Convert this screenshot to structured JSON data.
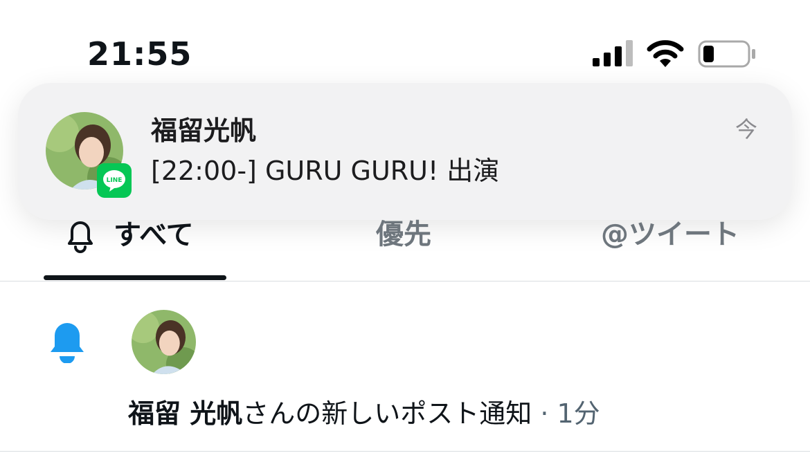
{
  "status_bar": {
    "time": "21:55",
    "icons": [
      "cellular-signal-icon",
      "wifi-icon",
      "battery-icon"
    ]
  },
  "notification_banner": {
    "app_icon": "line-icon",
    "badge_text": "LINE",
    "title": "福留光帆",
    "body": "[22:00-] GURU GURU! 出演",
    "time": "今",
    "colors": {
      "line_green": "#06c755",
      "background": "#f2f2f3"
    }
  },
  "tabs": {
    "items": [
      {
        "label": "すべて",
        "icon": "bell-outline-icon",
        "active": true
      },
      {
        "label": "優先",
        "active": false
      },
      {
        "label": "@ツイート",
        "active": false
      }
    ]
  },
  "notifications": [
    {
      "icon": "bell-filled-icon",
      "name": "福留 光帆",
      "text": "さんの新しいポスト通知",
      "separator": " · ",
      "time": "1分",
      "colors": {
        "bell": "#1d9bf0"
      }
    }
  ]
}
